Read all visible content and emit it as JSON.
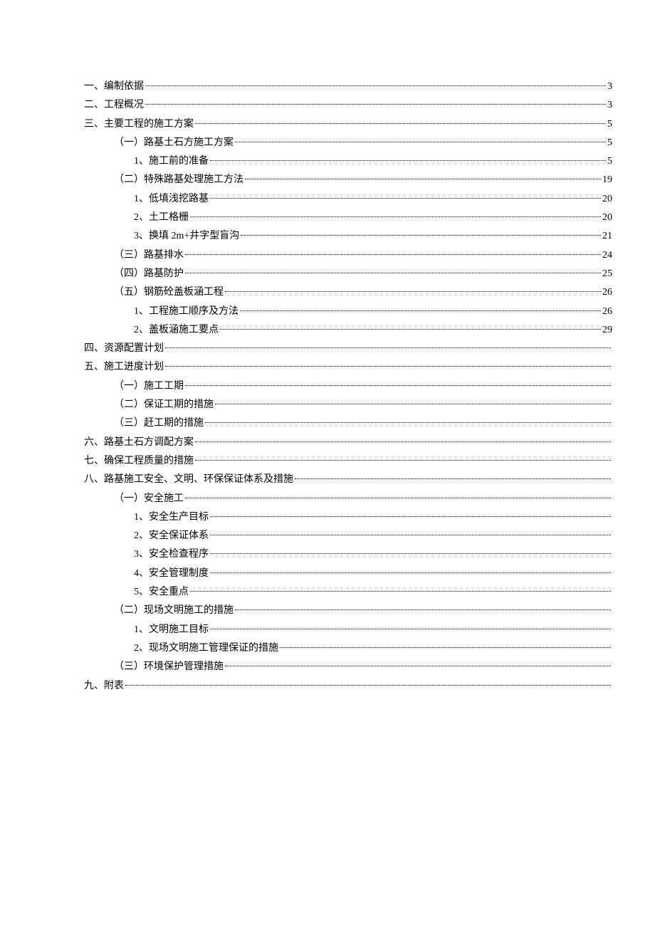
{
  "toc": [
    {
      "indent": 0,
      "text": "一、编制依据",
      "page": "3"
    },
    {
      "indent": 0,
      "text": "二、工程概况",
      "page": "3"
    },
    {
      "indent": 0,
      "text": "三、主要工程的施工方案",
      "page": "5"
    },
    {
      "indent": 1,
      "text": "（一）路基土石方施工方案",
      "page": "5"
    },
    {
      "indent": 2,
      "text": "1、施工前的准备",
      "page": "5"
    },
    {
      "indent": 1,
      "text": "（二）特殊路基处理施工方法",
      "page": "19"
    },
    {
      "indent": 2,
      "text": "1、低填浅挖路基",
      "page": "20"
    },
    {
      "indent": 2,
      "text": "2、土工格栅",
      "page": "20"
    },
    {
      "indent": 2,
      "text": "3、换填 2m+井字型盲沟",
      "page": "21"
    },
    {
      "indent": 1,
      "text": "（三）路基排水",
      "page": "24"
    },
    {
      "indent": 1,
      "text": "（四）路基防护",
      "page": "25"
    },
    {
      "indent": 1,
      "text": "（五）钢筋砼盖板涵工程",
      "page": "26"
    },
    {
      "indent": 2,
      "text": "1、工程施工顺序及方法",
      "page": "26"
    },
    {
      "indent": 2,
      "text": "2、盖板涵施工要点",
      "page": "29"
    },
    {
      "indent": 0,
      "text": "四、资源配置计划",
      "page": ""
    },
    {
      "indent": 0,
      "text": "五、施工进度计划",
      "page": ""
    },
    {
      "indent": 1,
      "text": "（一）施工工期",
      "page": ""
    },
    {
      "indent": 1,
      "text": "（二）保证工期的措施",
      "page": ""
    },
    {
      "indent": 1,
      "text": "（三）赶工期的措施",
      "page": ""
    },
    {
      "indent": 0,
      "text": "六、路基土石方调配方案",
      "page": ""
    },
    {
      "indent": 0,
      "text": "七、确保工程质量的措施",
      "page": ""
    },
    {
      "indent": 0,
      "text": "八、路基施工安全、文明、环保保证体系及措施",
      "page": ""
    },
    {
      "indent": 1,
      "text": "（一）安全施工",
      "page": ""
    },
    {
      "indent": 2,
      "text": "1、安全生产目标",
      "page": ""
    },
    {
      "indent": 2,
      "text": "2、安全保证体系",
      "page": ""
    },
    {
      "indent": 2,
      "text": "3、安全检查程序",
      "page": ""
    },
    {
      "indent": 2,
      "text": "4、安全管理制度",
      "page": ""
    },
    {
      "indent": 2,
      "text": "5、安全重点",
      "page": ""
    },
    {
      "indent": 1,
      "text": "（二）现场文明施工的措施",
      "page": ""
    },
    {
      "indent": 2,
      "text": "1、文明施工目标",
      "page": ""
    },
    {
      "indent": 2,
      "text": "2、现场文明施工管理保证的措施",
      "page": ""
    },
    {
      "indent": 1,
      "text": "（三）环境保护管理措施",
      "page": ""
    },
    {
      "indent": 0,
      "text": "九、附表",
      "page": ""
    }
  ]
}
